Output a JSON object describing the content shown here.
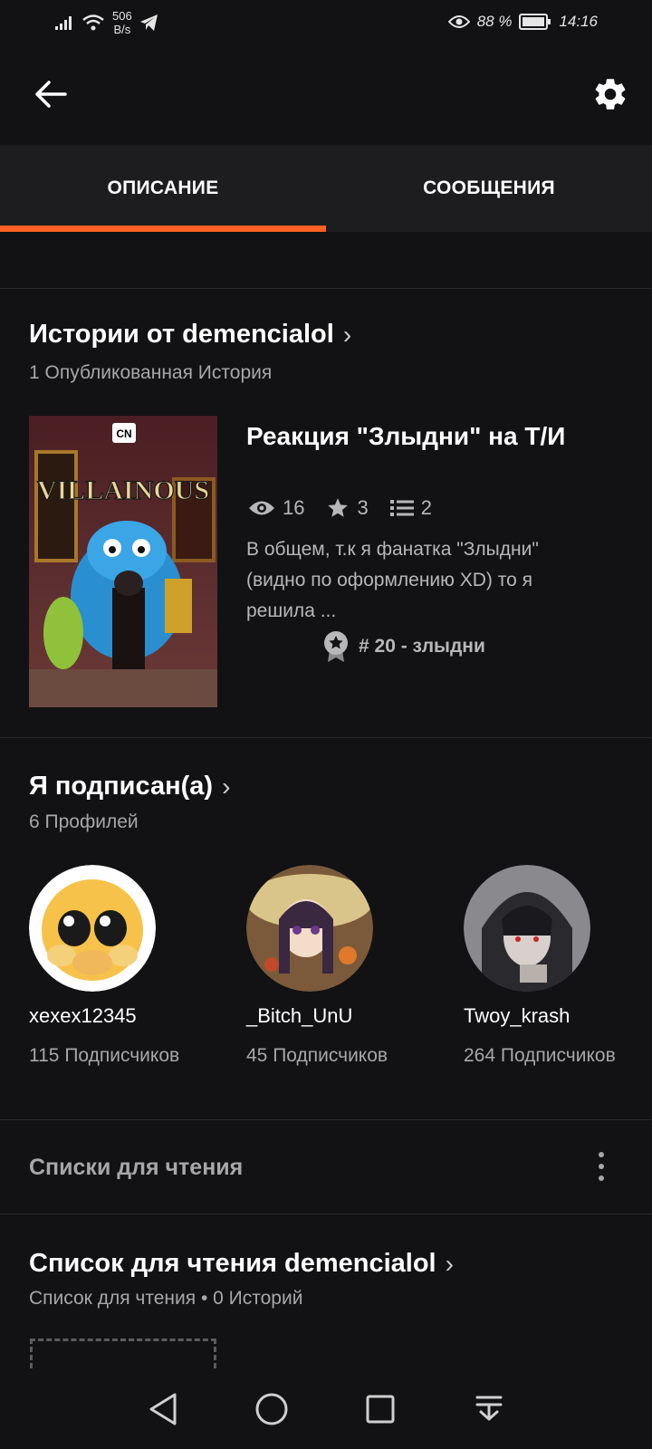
{
  "status_bar": {
    "net_speed_value": "506",
    "net_speed_unit": "B/s",
    "battery": "88 %",
    "time": "14:16"
  },
  "tabs": [
    {
      "label": "ОПИСАНИЕ",
      "active": true
    },
    {
      "label": "СООБЩЕНИЯ",
      "active": false
    }
  ],
  "stories": {
    "title": "Истории от demencialol",
    "subtitle": "1 Опубликованная История",
    "item": {
      "title": "Реакция \"Злыдни\" на Т/И",
      "cover_text": "VILLAINOUS",
      "views": "16",
      "votes": "3",
      "parts": "2",
      "description": "В общем, т.к я фанатка \"Злыдни\" (видно по оформлению XD) то я решила ...",
      "rank": "# 20 - злыдни"
    }
  },
  "following": {
    "title": "Я подписан(а)",
    "subtitle": "6 Профилей",
    "profiles": [
      {
        "name": "xexex12345",
        "followers": "115 Подписчиков"
      },
      {
        "name": "_Bitch_UnU",
        "followers": "45 Подписчиков"
      },
      {
        "name": "Twoy_krash",
        "followers": "264 Подписчиков"
      }
    ]
  },
  "reading_lists": {
    "label": "Списки для чтения",
    "list_title": "Список для чтения demencialol",
    "list_subtitle": "Список для чтения • 0 Историй"
  },
  "colors": {
    "accent": "#ff6122",
    "background": "#121113",
    "tab_bg": "#1d1c1e",
    "muted_text": "#a7a6a8"
  }
}
